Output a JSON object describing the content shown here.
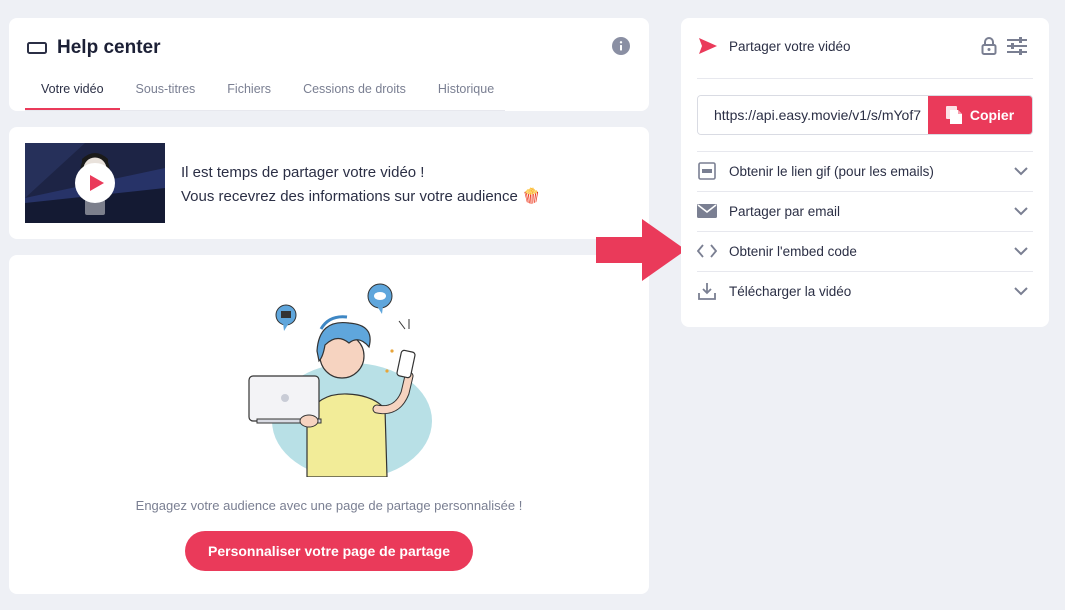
{
  "header": {
    "title": "Help center",
    "tabs": [
      {
        "label": "Votre vidéo",
        "active": true
      },
      {
        "label": "Sous-titres",
        "active": false
      },
      {
        "label": "Fichiers",
        "active": false
      },
      {
        "label": "Cessions de droits",
        "active": false
      },
      {
        "label": "Historique",
        "active": false
      }
    ]
  },
  "info": {
    "line1": "Il est temps de partager votre vidéo !",
    "line2": "Vous recevrez des informations sur votre audience 🍿"
  },
  "main": {
    "engage_text": "Engagez votre audience avec une page de partage personnalisée !",
    "cta_label": "Personnaliser votre page de partage"
  },
  "share": {
    "title": "Partager votre vidéo",
    "url": "https://api.easy.movie/v1/s/mYof7",
    "copy_label": "Copier",
    "options": [
      {
        "label": "Obtenir le lien gif (pour les emails)",
        "icon": "gif-icon"
      },
      {
        "label": "Partager par email",
        "icon": "email-icon"
      },
      {
        "label": "Obtenir l'embed code",
        "icon": "code-icon"
      },
      {
        "label": "Télécharger la vidéo",
        "icon": "download-icon"
      }
    ]
  },
  "colors": {
    "accent": "#ea3a5a",
    "background": "#eef0f5",
    "text": "#2b2f45",
    "muted": "#7a7f92"
  }
}
